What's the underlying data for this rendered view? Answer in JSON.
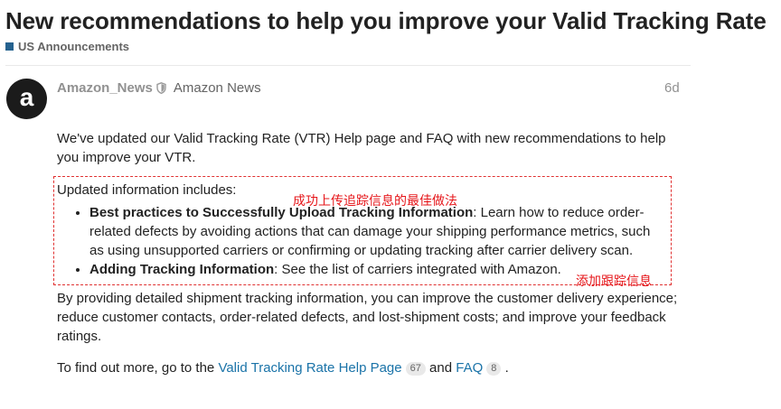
{
  "topic": {
    "title": "New recommendations to help you improve your Valid Tracking Rate",
    "category": "US Announcements",
    "category_color": "#25628f"
  },
  "post": {
    "avatar_letter": "a",
    "username": "Amazon_News",
    "full_name": "Amazon News",
    "date": "6d",
    "p1": "We've updated our Valid Tracking Rate (VTR) Help page and FAQ with new recommendations to help you improve your VTR.",
    "updated_intro": "Updated information includes:",
    "bullets": [
      {
        "bold": "Best practices to Successfully Upload Tracking Information",
        "text": ": Learn how to reduce order-related defects by avoiding actions that can damage your shipping performance metrics, such as using unsupported carriers or confirming or updating tracking after carrier delivery scan."
      },
      {
        "bold": "Adding Tracking Information",
        "text": ": See the list of carriers integrated with Amazon."
      }
    ],
    "p3": "By providing detailed shipment tracking information, you can improve the customer delivery experience; reduce customer contacts, order-related defects, and lost-shipment costs; and improve your feedback ratings.",
    "p4_prefix": "To find out more, go to the",
    "link1": "Valid Tracking Rate Help Page",
    "link1_count": "67",
    "p4_and": "and",
    "link2": "FAQ",
    "link2_count": "8",
    "p4_suffix": "."
  },
  "annotations": {
    "a1": "成功上传追踪信息的最佳做法",
    "a2": "添加跟踪信息",
    "color": "#e6161a"
  }
}
